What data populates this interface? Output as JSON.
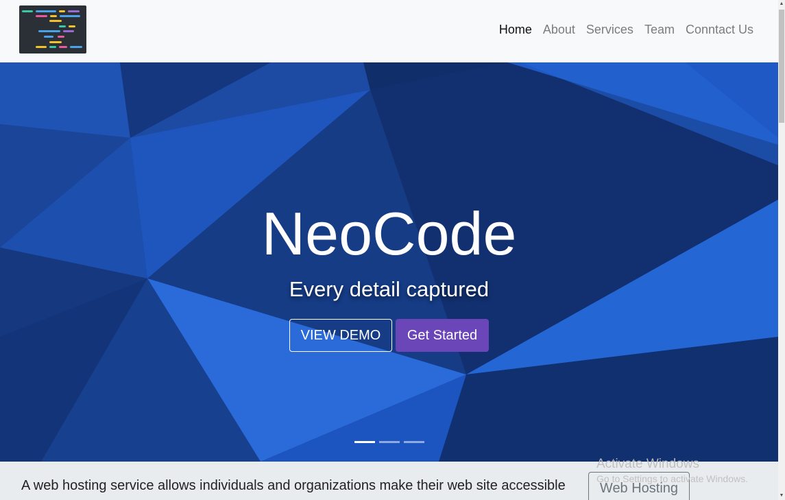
{
  "nav": {
    "logo_alt": "code logo",
    "links": [
      "Home",
      "About",
      "Services",
      "Team",
      "Conntact Us"
    ]
  },
  "hero": {
    "title": "NeoCode",
    "subtitle": "Every detail captured",
    "demo_button": "VIEW DEMO",
    "start_button": "Get Started",
    "slides": 3,
    "active_slide": 0
  },
  "info": {
    "text": "A web hosting service allows individuals and organizations make their web site accessible via the world Wide Web.",
    "hosting_button": "Web Hosting"
  },
  "watermark": {
    "title": "Activate Windows",
    "subtitle": "Go to Settings to activate Windows."
  },
  "colors": {
    "navbar_bg": "#f8f9fa",
    "hero_blue": "#1a4aa6",
    "accent_purple": "#6b46b8",
    "info_bg": "#e9ecef"
  },
  "icons": {
    "scroll_up": "scroll-up-arrow-icon",
    "scroll_down": "scroll-down-arrow-icon"
  }
}
